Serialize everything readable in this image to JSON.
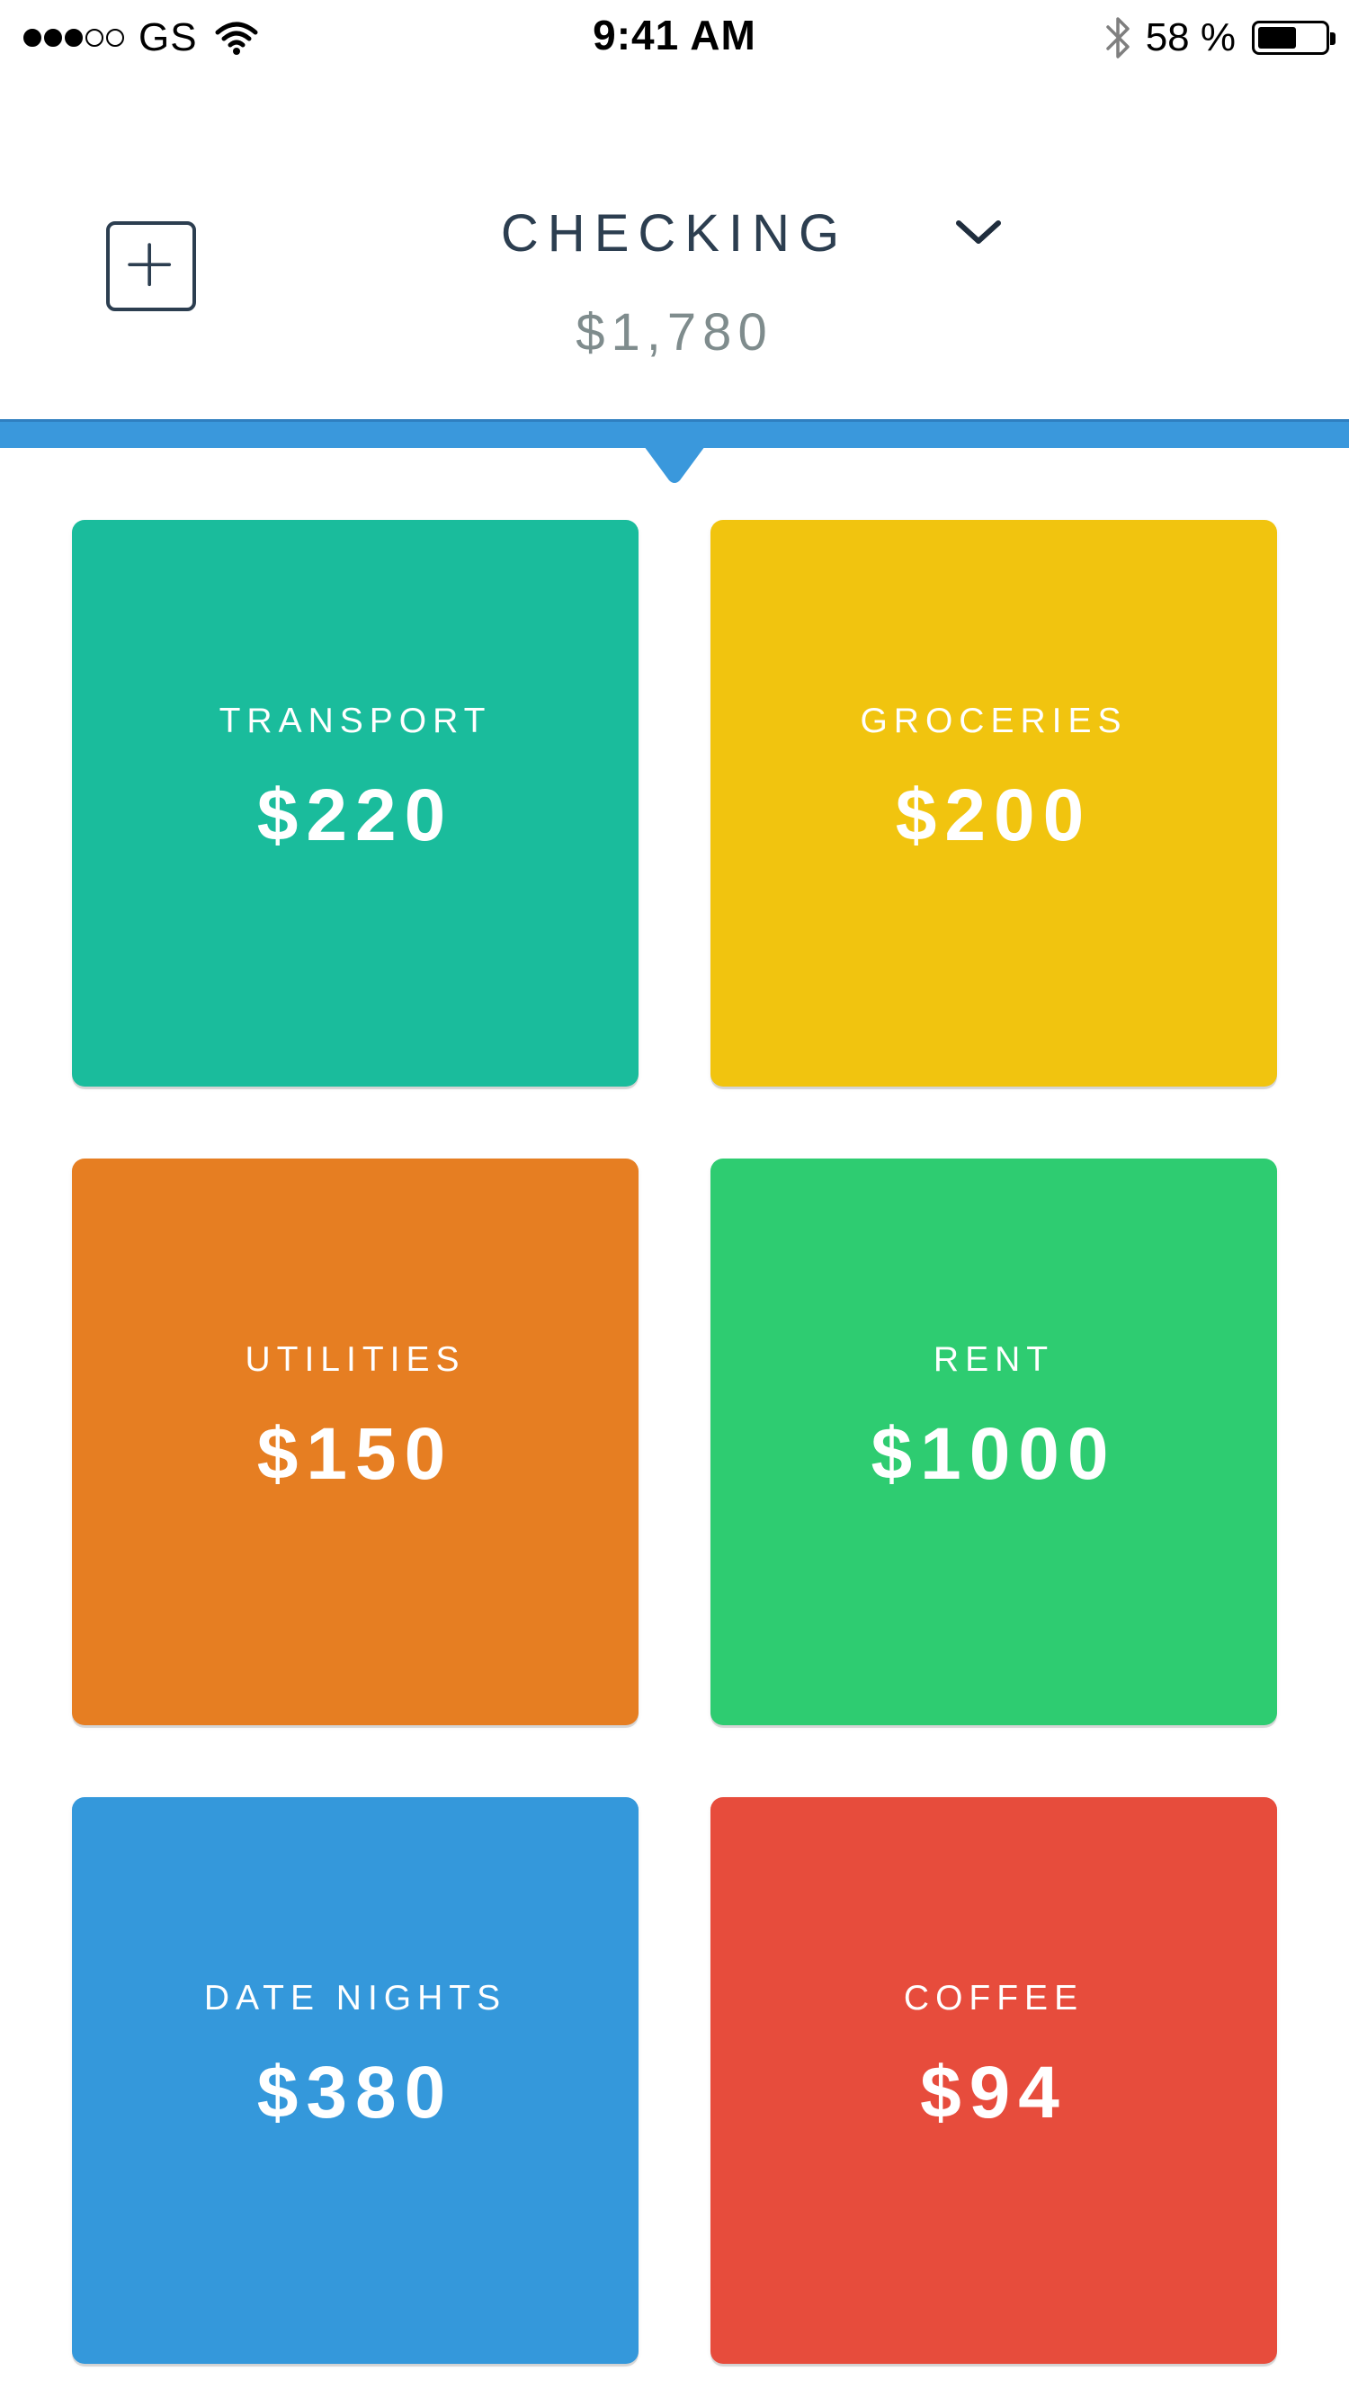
{
  "status_bar": {
    "carrier": "GS",
    "time": "9:41 AM",
    "battery_percent_label": "58 %",
    "battery_level": 0.58,
    "signal_bars_filled": 3,
    "signal_bars_total": 5,
    "icons": [
      "wifi-icon",
      "bluetooth-icon",
      "battery-icon"
    ]
  },
  "header": {
    "account_name": "CHECKING",
    "account_balance": "$1,780",
    "add_icon": "plus-square-icon",
    "dropdown_icon": "chevron-down-icon"
  },
  "colors": {
    "indicator_bar": "#3a98dc",
    "title_text": "#2c3e50",
    "balance_text": "#7f8c8d"
  },
  "categories": [
    {
      "name": "TRANSPORT",
      "amount": "$220",
      "color": "#1abc9c"
    },
    {
      "name": "GROCERIES",
      "amount": "$200",
      "color": "#f1c40f"
    },
    {
      "name": "UTILITIES",
      "amount": "$150",
      "color": "#e67e22"
    },
    {
      "name": "RENT",
      "amount": "$1000",
      "color": "#2ecc71"
    },
    {
      "name": "DATE NIGHTS",
      "amount": "$380",
      "color": "#3498db"
    },
    {
      "name": "COFFEE",
      "amount": "$94",
      "color": "#e74c3c"
    }
  ]
}
